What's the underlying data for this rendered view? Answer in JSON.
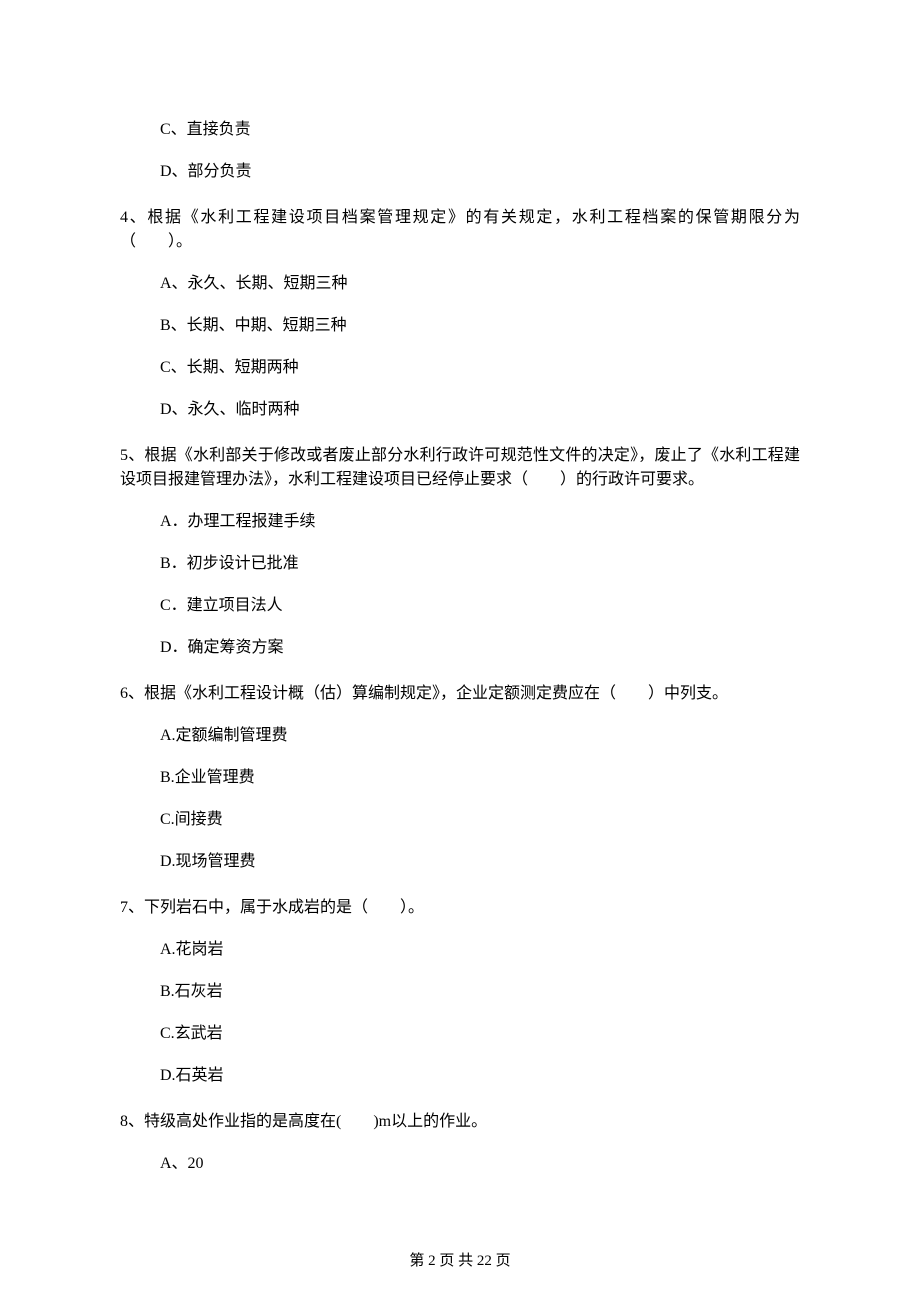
{
  "q3": {
    "options": {
      "C": "C、直接负责",
      "D": "D、部分负责"
    }
  },
  "q4": {
    "stem": "4、根据《水利工程建设项目档案管理规定》的有关规定，水利工程档案的保管期限分为（　　）。",
    "options": {
      "A": "A、永久、长期、短期三种",
      "B": "B、长期、中期、短期三种",
      "C": "C、长期、短期两种",
      "D": "D、永久、临时两种"
    }
  },
  "q5": {
    "stem": "5、根据《水利部关于修改或者废止部分水利行政许可规范性文件的决定》，废止了《水利工程建设项目报建管理办法》，水利工程建设项目已经停止要求（　　）的行政许可要求。",
    "options": {
      "A": "A．办理工程报建手续",
      "B": "B．初步设计已批准",
      "C": "C．建立项目法人",
      "D": "D．确定筹资方案"
    }
  },
  "q6": {
    "stem": "6、根据《水利工程设计概（估）算编制规定》，企业定额测定费应在（　　）中列支。",
    "options": {
      "A": "A.定额编制管理费",
      "B": "B.企业管理费",
      "C": "C.间接费",
      "D": "D.现场管理费"
    }
  },
  "q7": {
    "stem": "7、下列岩石中，属于水成岩的是（　　）。",
    "options": {
      "A": "A.花岗岩",
      "B": "B.石灰岩",
      "C": "C.玄武岩",
      "D": "D.石英岩"
    }
  },
  "q8": {
    "stem": "8、特级高处作业指的是高度在(　　)m以上的作业。",
    "options": {
      "A": "A、20"
    }
  },
  "footer": "第 2 页 共 22 页"
}
